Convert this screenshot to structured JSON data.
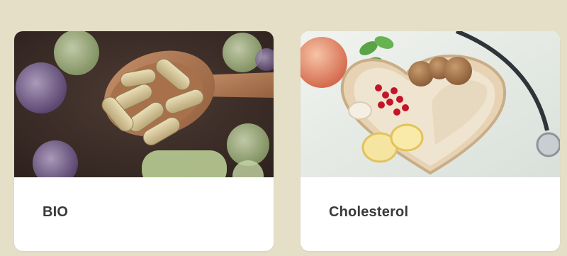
{
  "cards": [
    {
      "label": "BIO",
      "image": "capsules-on-wooden-spoon-photo"
    },
    {
      "label": "Cholesterol",
      "image": "heart-bowl-healthy-food-photo"
    }
  ],
  "colors": {
    "page_background": "#e4dfc6",
    "card_background": "#ffffff",
    "label_text": "#3a3a3a"
  }
}
